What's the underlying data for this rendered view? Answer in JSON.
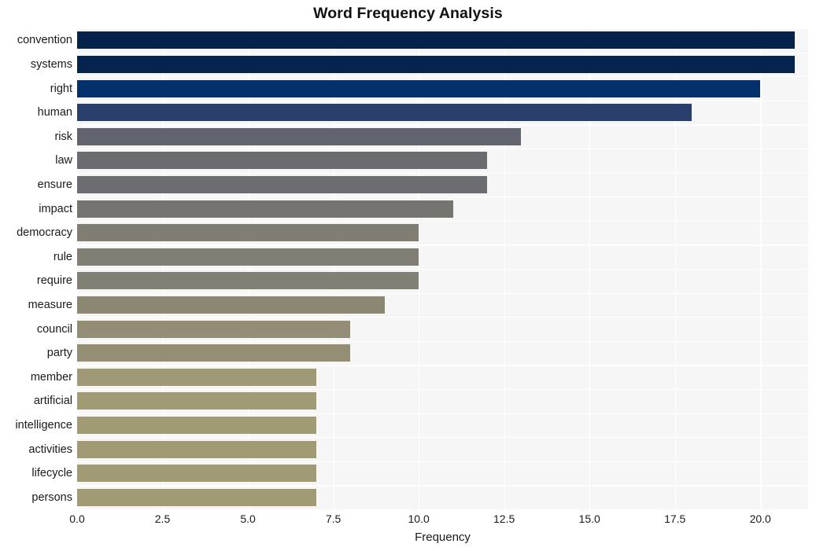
{
  "chart_data": {
    "type": "bar",
    "orientation": "horizontal",
    "title": "Word Frequency Analysis",
    "xlabel": "Frequency",
    "ylabel": "",
    "categories": [
      "convention",
      "systems",
      "right",
      "human",
      "risk",
      "law",
      "ensure",
      "impact",
      "democracy",
      "rule",
      "require",
      "measure",
      "council",
      "party",
      "member",
      "artificial",
      "intelligence",
      "activities",
      "lifecycle",
      "persons"
    ],
    "values": [
      21,
      21,
      20,
      18,
      13,
      12,
      12,
      11,
      10,
      10,
      10,
      9,
      8,
      8,
      7,
      7,
      7,
      7,
      7,
      7
    ],
    "bar_colors": [
      "#05224b",
      "#05234c",
      "#04306c",
      "#2b3f6d",
      "#61636f",
      "#6b6c70",
      "#6c6d70",
      "#757470",
      "#807e73",
      "#817f74",
      "#827f74",
      "#8b8773",
      "#928d74",
      "#938e74",
      "#9f9975",
      "#a09a75",
      "#a09a75",
      "#a09a75",
      "#a09a75",
      "#a09a75"
    ],
    "xticks": [
      "0.0",
      "2.5",
      "5.0",
      "7.5",
      "10.0",
      "12.5",
      "15.0",
      "17.5",
      "20.0"
    ],
    "xtick_values": [
      0.0,
      2.5,
      5.0,
      7.5,
      10.0,
      12.5,
      15.0,
      17.5,
      20.0
    ],
    "xlim": [
      0,
      21.4
    ],
    "grid": true,
    "grid_color": "#ffffff",
    "plot_background": "#f6f6f6",
    "figure_background": "#ffffff",
    "legend": null
  }
}
